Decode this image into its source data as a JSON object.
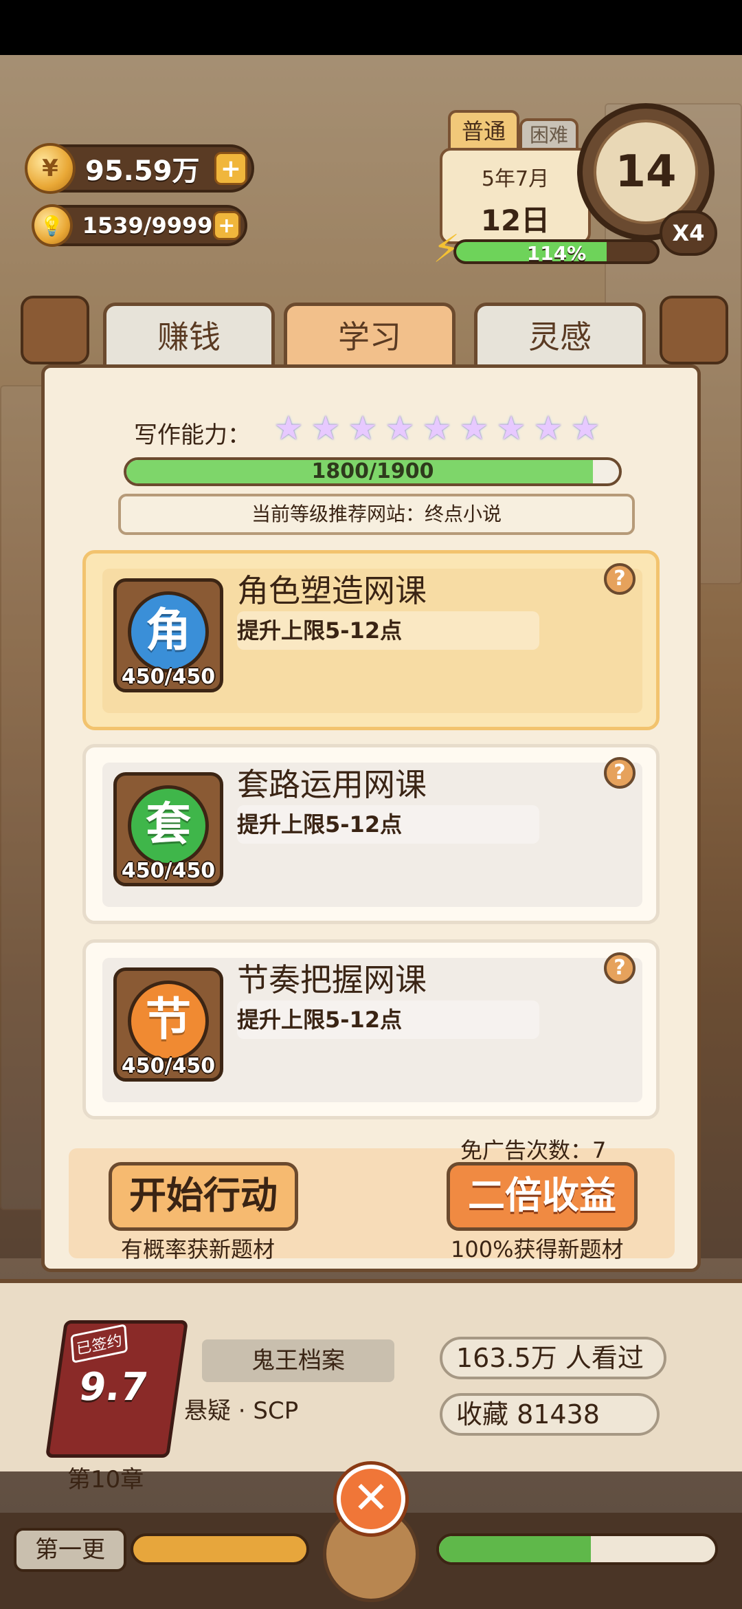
{
  "resources": {
    "money": "95.59万",
    "energy_points": "1539/9999"
  },
  "calendar": {
    "difficulty_active": "普通",
    "difficulty_other": "困难",
    "month": "5年7月",
    "day": "12日",
    "clock_value": "14",
    "speed": "X4",
    "progress_text": "114%",
    "progress_fraction": 0.75
  },
  "tabs": [
    {
      "label": "赚钱"
    },
    {
      "label": "学习"
    },
    {
      "label": "灵感"
    }
  ],
  "skill": {
    "label": "写作能力：",
    "stars": 9,
    "xp_text": "1800/1900",
    "xp_fraction": 0.947,
    "recommend": "当前等级推荐网站：终点小说"
  },
  "courses": [
    {
      "icon_char": "角",
      "icon_color": "#3a8fd8",
      "count": "450/450",
      "title": "角色塑造网课",
      "desc": "提升上限5-12点",
      "selected": true
    },
    {
      "icon_char": "套",
      "icon_color": "#3fb64a",
      "count": "450/450",
      "title": "套路运用网课",
      "desc": "提升上限5-12点",
      "selected": false
    },
    {
      "icon_char": "节",
      "icon_color": "#f08a32",
      "count": "450/450",
      "title": "节奏把握网课",
      "desc": "提升上限5-12点",
      "selected": false
    }
  ],
  "footer": {
    "ad_count": "免广告次数：7",
    "start_label": "开始行动",
    "start_sub": "有概率获新题材",
    "double_label": "二倍收益",
    "double_sub": "100%获得新题材"
  },
  "book": {
    "seal": "已签约",
    "score": "9.7",
    "chapter": "第10章",
    "title": "鬼王档案",
    "genre": "悬疑 · SCP",
    "views": "163.5万 人看过",
    "favorites": "收藏 81438"
  },
  "bottom": {
    "first_update": "第一更",
    "close": "✕"
  }
}
